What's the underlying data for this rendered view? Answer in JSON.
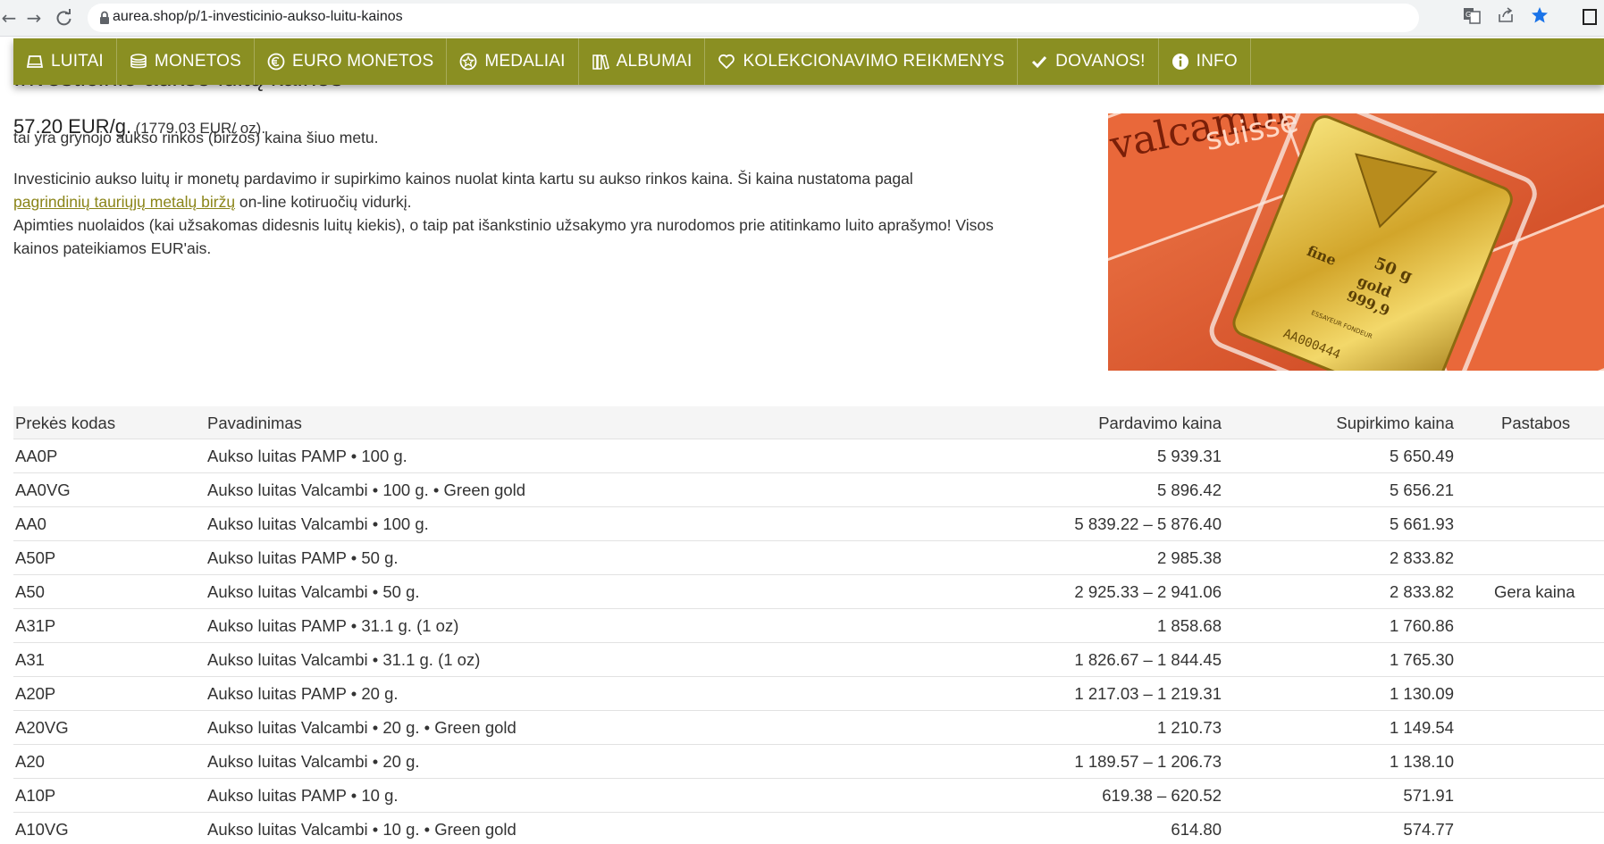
{
  "browser": {
    "url": "aurea.shop/p/1-investicinio-aukso-luitu-kainos",
    "icons": [
      "back-icon",
      "forward-icon",
      "reload-icon",
      "lock-icon",
      "translate-icon",
      "share-icon",
      "bookmark-star-icon",
      "sidebar-icon"
    ]
  },
  "nav": {
    "items": [
      {
        "label": "LUITAI",
        "icon": "gold-bar-icon"
      },
      {
        "label": "MONETOS",
        "icon": "coins-stack-icon"
      },
      {
        "label": "EURO MONETOS",
        "icon": "euro-coin-icon"
      },
      {
        "label": "MEDALIAI",
        "icon": "medal-icon"
      },
      {
        "label": "ALBUMAI",
        "icon": "books-icon"
      },
      {
        "label": "KOLEKCIONAVIMO REIKMENYS",
        "icon": "heart-icon"
      },
      {
        "label": "DOVANOS!",
        "icon": "check-icon"
      },
      {
        "label": "INFO",
        "icon": "info-icon"
      }
    ],
    "color": "#8a8f22"
  },
  "page": {
    "heading": "Investicinio aukso luitų kainos",
    "price_g": "57.20 EUR/g.",
    "price_oz": "(1779.03 EUR/ oz).",
    "price_note": "tai yra grynojo aukso rinkos (biržos) kaina šiuo metu.",
    "para1_a": "Investicinio aukso luitų ir monetų pardavimo ir supirkimo kainos nuolat kinta kartu su aukso rinkos kaina. Ši kaina nustatoma pagal",
    "para1_link": "pagrindinių tauriųjų metalų biržų",
    "para1_b": " on-line kotiruočių vidurkį.",
    "para2": "Apimties nuolaidos (kai užsakomas didesnis luitų kiekis), o taip pat išankstinio užsakymo yra nurodomos prie atitinkamo luito aprašymo! Visos kainos pateikiamos EUR'ais."
  },
  "image": {
    "text_brand": "valcambi",
    "text_suisse": "suisse",
    "text_50g": "50 g",
    "text_fine": "fine",
    "text_gold": "gold",
    "text_999": "999,9",
    "text_essayeur": "ESSAYEUR FONDEUR",
    "text_serial": "AA000444"
  },
  "table": {
    "headers": {
      "code": "Prekės kodas",
      "name": "Pavadinimas",
      "sell": "Pardavimo kaina",
      "buy": "Supirkimo kaina",
      "note": "Pastabos"
    },
    "rows": [
      {
        "code": "AA0P",
        "name": "Aukso luitas PAMP • 100 g.",
        "sell": "5 939.31",
        "buy": "5 650.49",
        "note": ""
      },
      {
        "code": "AA0VG",
        "name": "Aukso luitas Valcambi • 100 g. • Green gold",
        "sell": "5 896.42",
        "buy": "5 656.21",
        "note": ""
      },
      {
        "code": "AA0",
        "name": "Aukso luitas Valcambi • 100 g.",
        "sell": "5 839.22 – 5 876.40",
        "buy": "5 661.93",
        "note": ""
      },
      {
        "code": "A50P",
        "name": "Aukso luitas PAMP • 50 g.",
        "sell": "2 985.38",
        "buy": "2 833.82",
        "note": ""
      },
      {
        "code": "A50",
        "name": "Aukso luitas Valcambi • 50 g.",
        "sell": "2 925.33 – 2 941.06",
        "buy": "2 833.82",
        "note": "Gera kaina"
      },
      {
        "code": "A31P",
        "name": "Aukso luitas PAMP • 31.1 g. (1 oz)",
        "sell": "1 858.68",
        "buy": "1 760.86",
        "note": ""
      },
      {
        "code": "A31",
        "name": "Aukso luitas Valcambi • 31.1 g. (1 oz)",
        "sell": "1 826.67 – 1 844.45",
        "buy": "1 765.30",
        "note": ""
      },
      {
        "code": "A20P",
        "name": "Aukso luitas PAMP • 20 g.",
        "sell": "1 217.03 – 1 219.31",
        "buy": "1 130.09",
        "note": ""
      },
      {
        "code": "A20VG",
        "name": "Aukso luitas Valcambi • 20 g. • Green gold",
        "sell": "1 210.73",
        "buy": "1 149.54",
        "note": ""
      },
      {
        "code": "A20",
        "name": "Aukso luitas Valcambi • 20 g.",
        "sell": "1 189.57 – 1 206.73",
        "buy": "1 138.10",
        "note": ""
      },
      {
        "code": "A10P",
        "name": "Aukso luitas PAMP • 10 g.",
        "sell": "619.38 – 620.52",
        "buy": "571.91",
        "note": ""
      },
      {
        "code": "A10VG",
        "name": "Aukso luitas Valcambi • 10 g. • Green gold",
        "sell": "614.80",
        "buy": "574.77",
        "note": ""
      }
    ]
  }
}
